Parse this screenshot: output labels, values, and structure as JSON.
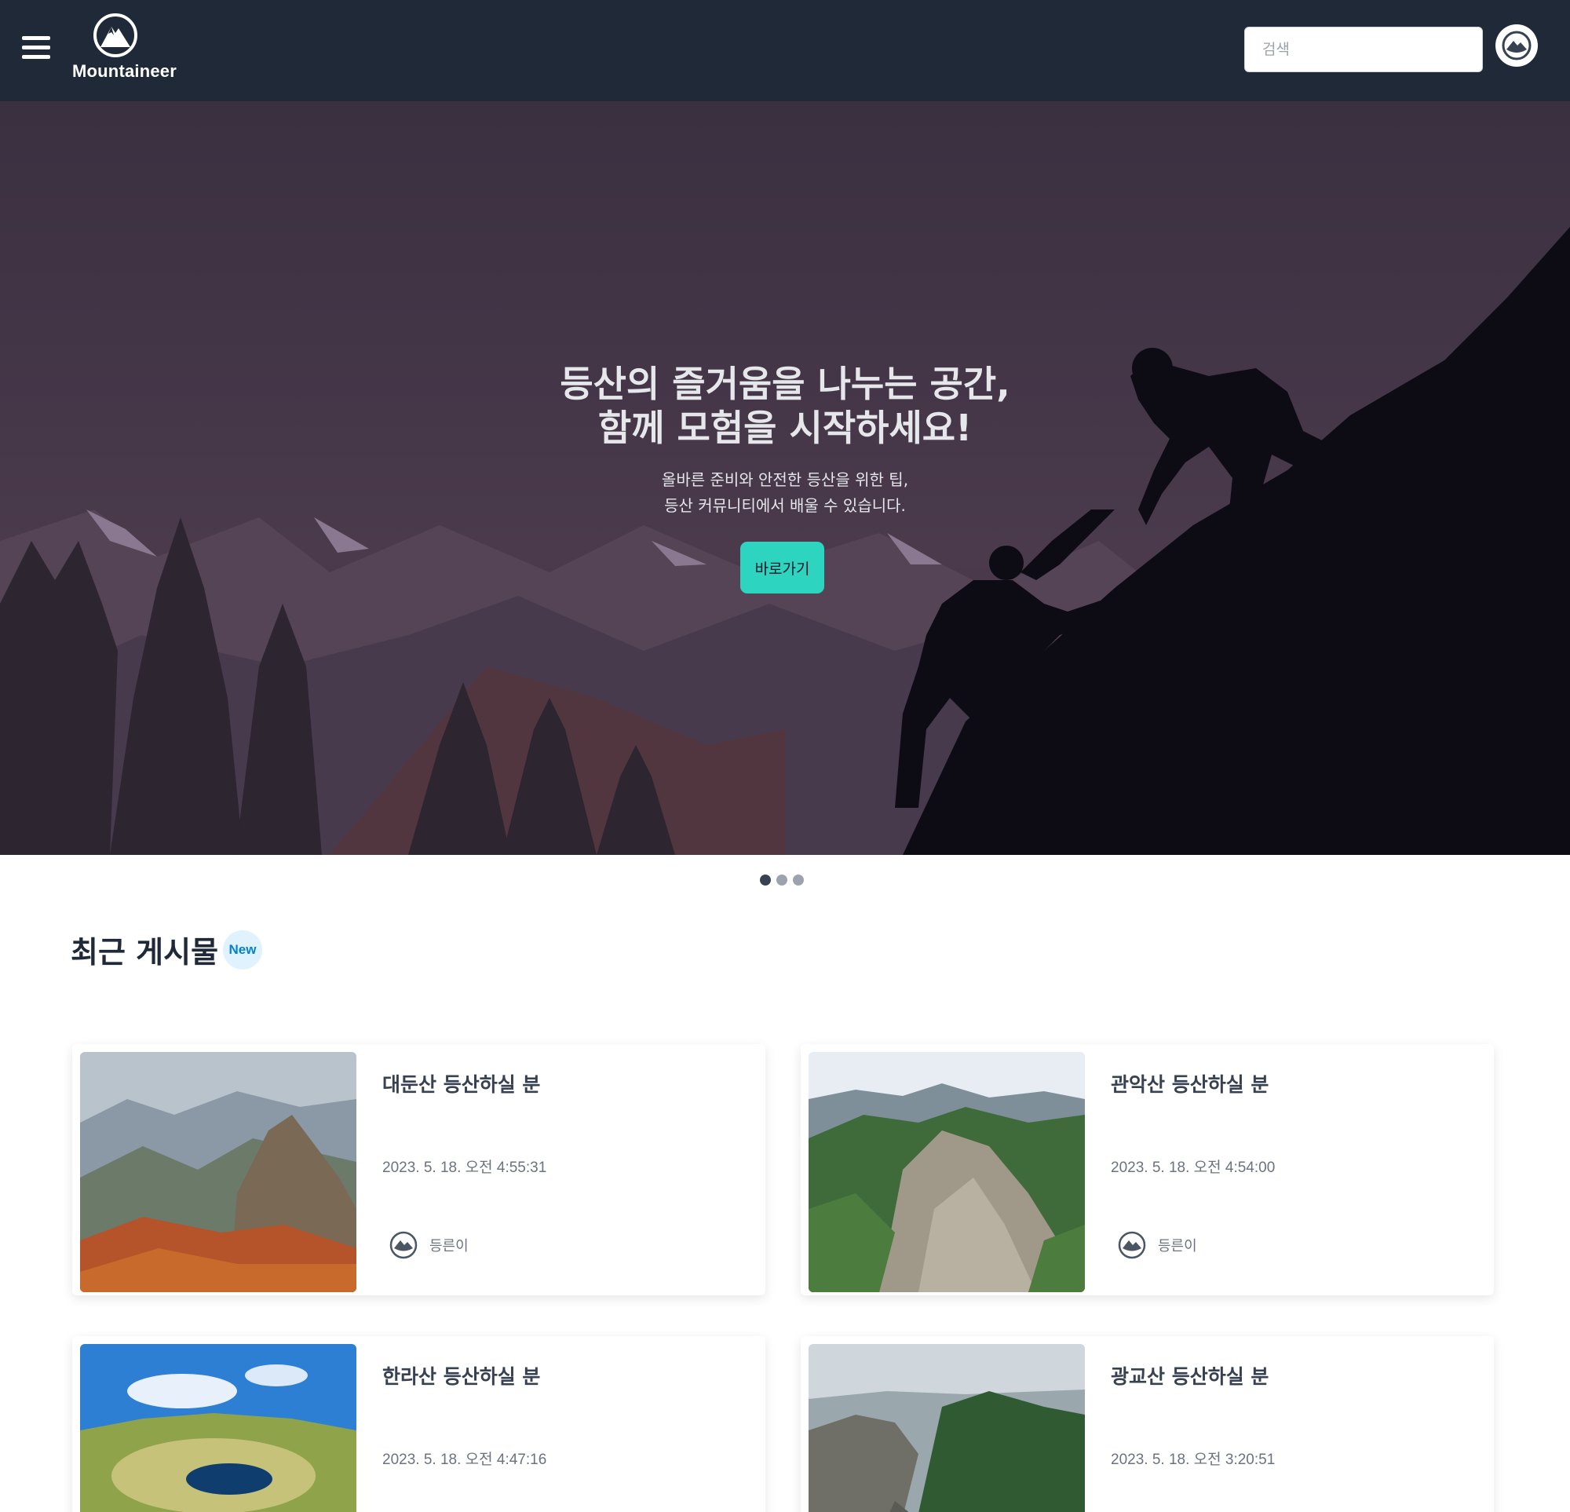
{
  "header": {
    "logo_text": "Mountaineer",
    "search_placeholder": "검색"
  },
  "hero": {
    "title_line1": "등산의 즐거움을 나누는 공간,",
    "title_line2": "함께 모험을 시작하세요!",
    "subtitle_line1": "올바른 준비와 안전한 등산을 위한 팁,",
    "subtitle_line2": "등산 커뮤니티에서 배울 수 있습니다.",
    "cta_label": "바로가기",
    "slide_count": 3,
    "active_slide": 1
  },
  "recent": {
    "title": "최근 게시물",
    "badge": "New",
    "posts": [
      {
        "title": "대둔산 등산하실 분",
        "date": "2023. 5. 18. 오전 4:55:31",
        "author": "등른이"
      },
      {
        "title": "관악산 등산하실 분",
        "date": "2023. 5. 18. 오전 4:54:00",
        "author": "등른이"
      },
      {
        "title": "한라산 등산하실 분",
        "date": "2023. 5. 18. 오전 4:47:16",
        "author": ""
      },
      {
        "title": "광교산 등산하실 분",
        "date": "2023. 5. 18. 오전 3:20:51",
        "author": ""
      }
    ]
  },
  "colors": {
    "header_bg": "#1f2937",
    "accent": "#2dd4bf",
    "badge_bg": "#e0f2fe",
    "badge_text": "#0284c7"
  }
}
